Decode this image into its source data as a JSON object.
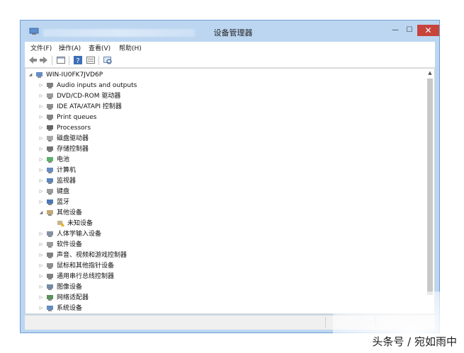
{
  "window": {
    "title": "设备管理器"
  },
  "titlebar": {
    "minimize_glyph": "—",
    "maximize_glyph": "☐",
    "close_glyph": "✕"
  },
  "menu": [
    {
      "label": "文件(F)"
    },
    {
      "label": "操作(A)"
    },
    {
      "label": "查看(V)"
    },
    {
      "label": "帮助(H)"
    }
  ],
  "toolbar": {
    "icons": [
      "back-icon",
      "forward-icon",
      "properties-icon",
      "help-icon",
      "update-driver-icon",
      "scan-hardware-icon"
    ]
  },
  "tree": {
    "root": {
      "label": "WIN-IU0FK7JVD6P",
      "icon": "computer-icon"
    },
    "items": [
      {
        "label": "Audio inputs and outputs",
        "icon": "speaker-icon"
      },
      {
        "label": "DVD/CD-ROM 驱动器",
        "icon": "disc-drive-icon"
      },
      {
        "label": "IDE ATA/ATAPI 控制器",
        "icon": "ide-controller-icon"
      },
      {
        "label": "Print queues",
        "icon": "printer-icon"
      },
      {
        "label": "Processors",
        "icon": "processor-icon"
      },
      {
        "label": "磁盘驱动器",
        "icon": "disk-drive-icon"
      },
      {
        "label": "存储控制器",
        "icon": "storage-controller-icon"
      },
      {
        "label": "电池",
        "icon": "battery-icon"
      },
      {
        "label": "计算机",
        "icon": "computer-icon"
      },
      {
        "label": "监视器",
        "icon": "monitor-icon"
      },
      {
        "label": "键盘",
        "icon": "keyboard-icon"
      },
      {
        "label": "蓝牙",
        "icon": "bluetooth-icon"
      },
      {
        "label": "其他设备",
        "icon": "other-devices-icon",
        "expanded": true
      },
      {
        "label": "未知设备",
        "icon": "unknown-device-warning-icon",
        "child": true
      },
      {
        "label": "人体学输入设备",
        "icon": "hid-icon"
      },
      {
        "label": "软件设备",
        "icon": "software-device-icon"
      },
      {
        "label": "声音、视频和游戏控制器",
        "icon": "sound-icon"
      },
      {
        "label": "鼠标和其他指针设备",
        "icon": "mouse-icon"
      },
      {
        "label": "通用串行总线控制器",
        "icon": "usb-icon"
      },
      {
        "label": "图像设备",
        "icon": "imaging-device-icon"
      },
      {
        "label": "网络适配器",
        "icon": "network-adapter-icon"
      },
      {
        "label": "系统设备",
        "icon": "system-device-icon"
      }
    ]
  },
  "watermark": {
    "text": "头条号 / 宛如雨中"
  },
  "colors": {
    "frame": "#bcd6f1",
    "close": "#c7443d",
    "selection": "#cce8ff"
  }
}
